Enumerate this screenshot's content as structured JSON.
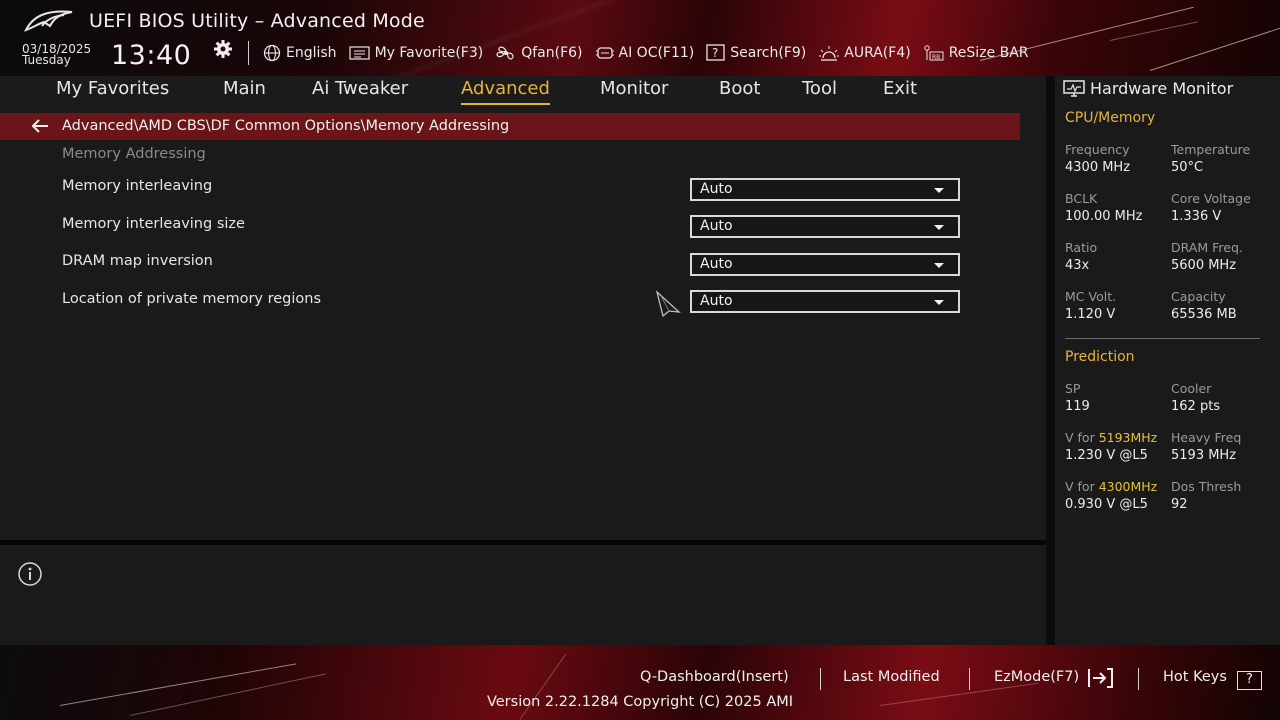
{
  "header": {
    "title": "UEFI BIOS Utility – Advanced Mode",
    "date": "03/18/2025",
    "day": "Tuesday",
    "time": "13:40",
    "toolbar": [
      {
        "label": "English",
        "icon": "globe-icon"
      },
      {
        "label": "My Favorite(F3)",
        "icon": "favorite-icon"
      },
      {
        "label": "Qfan(F6)",
        "icon": "fan-icon"
      },
      {
        "label": "AI OC(F11)",
        "icon": "ai-chip-icon"
      },
      {
        "label": "Search(F9)",
        "icon": "search-icon"
      },
      {
        "label": "AURA(F4)",
        "icon": "aura-icon"
      },
      {
        "label": "ReSize BAR",
        "icon": "resize-bar-icon"
      }
    ]
  },
  "tabs": [
    {
      "label": "My Favorites"
    },
    {
      "label": "Main"
    },
    {
      "label": "Ai Tweaker"
    },
    {
      "label": "Advanced",
      "active": true
    },
    {
      "label": "Monitor"
    },
    {
      "label": "Boot"
    },
    {
      "label": "Tool"
    },
    {
      "label": "Exit"
    }
  ],
  "breadcrumb": "Advanced\\AMD CBS\\DF Common Options\\Memory Addressing",
  "section_title": "Memory Addressing",
  "settings": [
    {
      "label": "Memory interleaving",
      "value": "Auto"
    },
    {
      "label": "Memory interleaving size",
      "value": "Auto"
    },
    {
      "label": "DRAM map inversion",
      "value": "Auto"
    },
    {
      "label": "Location of private memory regions",
      "value": "Auto"
    }
  ],
  "hardware_monitor": {
    "title": "Hardware Monitor",
    "cpu_memory": {
      "heading": "CPU/Memory",
      "items": [
        {
          "label": "Frequency",
          "value": "4300 MHz"
        },
        {
          "label": "Temperature",
          "value": "50°C"
        },
        {
          "label": "BCLK",
          "value": "100.00 MHz"
        },
        {
          "label": "Core Voltage",
          "value": "1.336 V"
        },
        {
          "label": "Ratio",
          "value": "43x"
        },
        {
          "label": "DRAM Freq.",
          "value": "5600 MHz"
        },
        {
          "label": "MC Volt.",
          "value": "1.120 V"
        },
        {
          "label": "Capacity",
          "value": "65536 MB"
        }
      ]
    },
    "prediction": {
      "heading": "Prediction",
      "sp_label": "SP",
      "sp_value": "119",
      "cooler_label": "Cooler",
      "cooler_value": "162 pts",
      "v_for_prefix": "V for ",
      "v1_freq": "5193MHz",
      "v1_value": "1.230 V @L5",
      "heavy_label": "Heavy Freq",
      "heavy_value": "5193 MHz",
      "v2_freq": "4300MHz",
      "v2_value": "0.930 V @L5",
      "dos_label": "Dos Thresh",
      "dos_value": "92"
    }
  },
  "footer": {
    "qdashboard": "Q-Dashboard(Insert)",
    "last_modified": "Last Modified",
    "ezmode": "EzMode(F7)",
    "hotkeys": "Hot Keys",
    "hotkeys_icon": "?",
    "version": "Version 2.22.1284 Copyright (C) 2025 AMI"
  },
  "colors": {
    "accent": "#e8b33a",
    "breadcrumb_bg": "#6b1519",
    "background": "#1a1a1a"
  }
}
